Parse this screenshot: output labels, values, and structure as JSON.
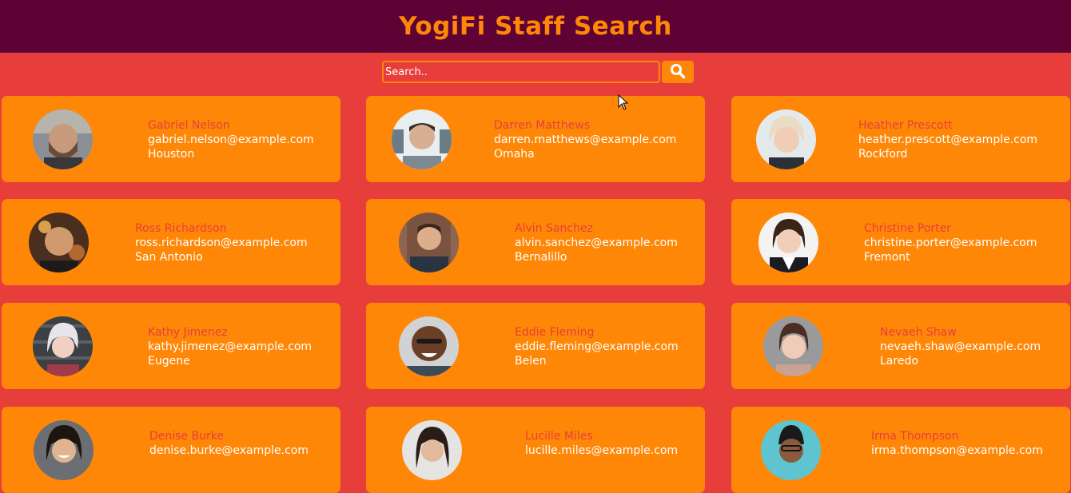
{
  "header": {
    "title": "YogiFi Staff Search"
  },
  "search": {
    "placeholder": "Search..",
    "button_icon": "search-icon"
  },
  "colors": {
    "header_bg": "#5e0236",
    "page_bg": "#e83e3b",
    "card_bg": "#ff8707",
    "name_text": "#e83e3b",
    "detail_text": "#ffffff",
    "title_text": "#ff8707"
  },
  "employees": [
    {
      "name": "Gabriel Nelson",
      "email": "gabriel.nelson@example.com",
      "city": "Houston"
    },
    {
      "name": "Darren Matthews",
      "email": "darren.matthews@example.com",
      "city": "Omaha"
    },
    {
      "name": "Heather Prescott",
      "email": "heather.prescott@example.com",
      "city": "Rockford"
    },
    {
      "name": "Ross Richardson",
      "email": "ross.richardson@example.com",
      "city": "San Antonio"
    },
    {
      "name": "Alvin Sanchez",
      "email": "alvin.sanchez@example.com",
      "city": "Bernalillo"
    },
    {
      "name": "Christine Porter",
      "email": "christine.porter@example.com",
      "city": "Fremont"
    },
    {
      "name": "Kathy Jimenez",
      "email": "kathy.jimenez@example.com",
      "city": "Eugene"
    },
    {
      "name": "Eddie Fleming",
      "email": "eddie.fleming@example.com",
      "city": "Belen"
    },
    {
      "name": "Nevaeh Shaw",
      "email": "nevaeh.shaw@example.com",
      "city": "Laredo"
    },
    {
      "name": "Denise Burke",
      "email": "denise.burke@example.com",
      "city": ""
    },
    {
      "name": "Lucille Miles",
      "email": "lucille.miles@example.com",
      "city": ""
    },
    {
      "name": "Irma Thompson",
      "email": "irma.thompson@example.com",
      "city": ""
    }
  ]
}
